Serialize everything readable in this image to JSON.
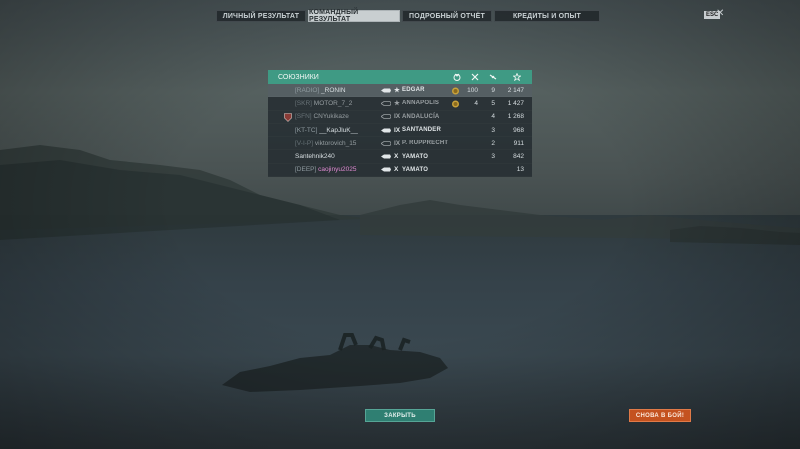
{
  "tabs": [
    {
      "label": "ЛИЧНЫЙ РЕЗУЛЬТАТ"
    },
    {
      "label": "КОМАНДНЫЙ РЕЗУЛЬТАТ"
    },
    {
      "label": "ПОДРОБНЫЙ ОТЧЁТ"
    },
    {
      "label": "КРЕДИТЫ И ОПЫТ"
    }
  ],
  "esc_label": "ESC",
  "close_glyph": "✕",
  "panel": {
    "title": "СОЮЗНИКИ",
    "columns": [
      "medal-icon",
      "kills-icon",
      "planes-icon",
      "score-icon"
    ],
    "rows": [
      {
        "clan": "[RADIO]",
        "name": "_RONIN",
        "tier": "★",
        "ship": "EDGAR",
        "col_a": "100",
        "col_b": "9",
        "col_c": "2 147",
        "medal": true
      },
      {
        "clan": "[SKR]",
        "name": "MOTOR_7_2",
        "tier": "★",
        "ship": "ANNAPOLIS",
        "col_a": "4",
        "col_b": "5",
        "col_c": "1 427",
        "medal": true
      },
      {
        "clan": "[SFN]",
        "name": "CNYukikaze",
        "tier": "IX",
        "ship": "ANDALUCÍA",
        "col_a": "",
        "col_b": "4",
        "col_c": "1 268",
        "medal": false
      },
      {
        "clan": "[KT-TC]",
        "name": "__KapJluK__",
        "tier": "IX",
        "ship": "SANTANDER",
        "col_a": "",
        "col_b": "3",
        "col_c": "968",
        "medal": false
      },
      {
        "clan": "[V-I-P]",
        "name": "viktorovich_15",
        "tier": "IX",
        "ship": "P. RUPPRECHT",
        "col_a": "",
        "col_b": "2",
        "col_c": "911",
        "medal": false
      },
      {
        "clan": "",
        "name": "Santehnik240",
        "tier": "X",
        "ship": "YAMATO",
        "col_a": "",
        "col_b": "3",
        "col_c": "842",
        "medal": false
      },
      {
        "clan": "[DEEP]",
        "name": "caojinyu2025",
        "tier": "X",
        "ship": "YAMATO",
        "col_a": "",
        "col_b": "",
        "col_c": "13",
        "medal": false
      }
    ]
  },
  "buttons": {
    "close": "ЗАКРЫТЬ",
    "battle": "СНОВА В БОЙ!"
  },
  "colors": {
    "accent": "#3f9a84",
    "battle": "#c4521f",
    "medal": "#c9a23a",
    "pink_name": "#e08ad2"
  }
}
